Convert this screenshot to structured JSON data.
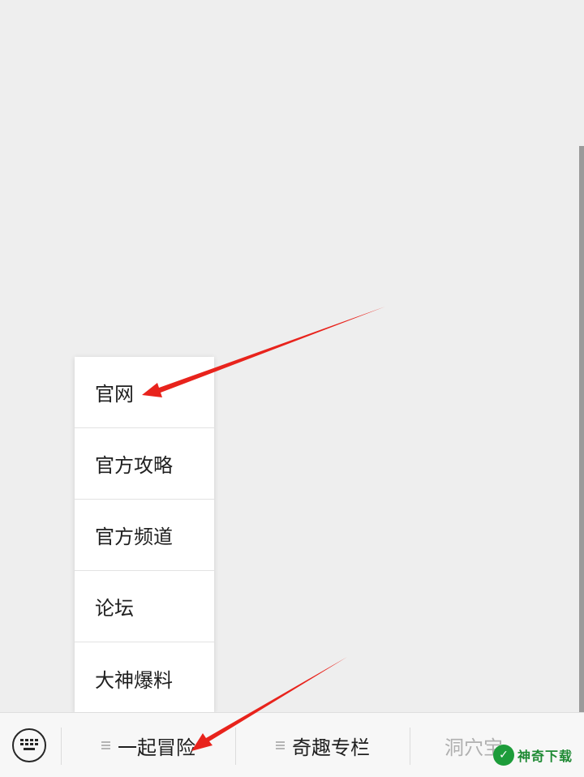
{
  "popup_menu": {
    "items": [
      {
        "label": "官网"
      },
      {
        "label": "官方攻略"
      },
      {
        "label": "官方频道"
      },
      {
        "label": "论坛"
      },
      {
        "label": "大神爆料"
      }
    ]
  },
  "bottom_bar": {
    "keyboard_icon": "keyboard-icon",
    "tabs": [
      {
        "label": "一起冒险",
        "icon": "menu-lines-icon"
      },
      {
        "label": "奇趣专栏",
        "icon": "menu-lines-icon"
      },
      {
        "label": "洞穴宝"
      }
    ]
  },
  "watermark": {
    "text": "神奇下载",
    "color": "#1d9c3a"
  },
  "colors": {
    "arrow": "#e8231c",
    "background": "#eeeeee",
    "menu_background": "#ffffff"
  }
}
